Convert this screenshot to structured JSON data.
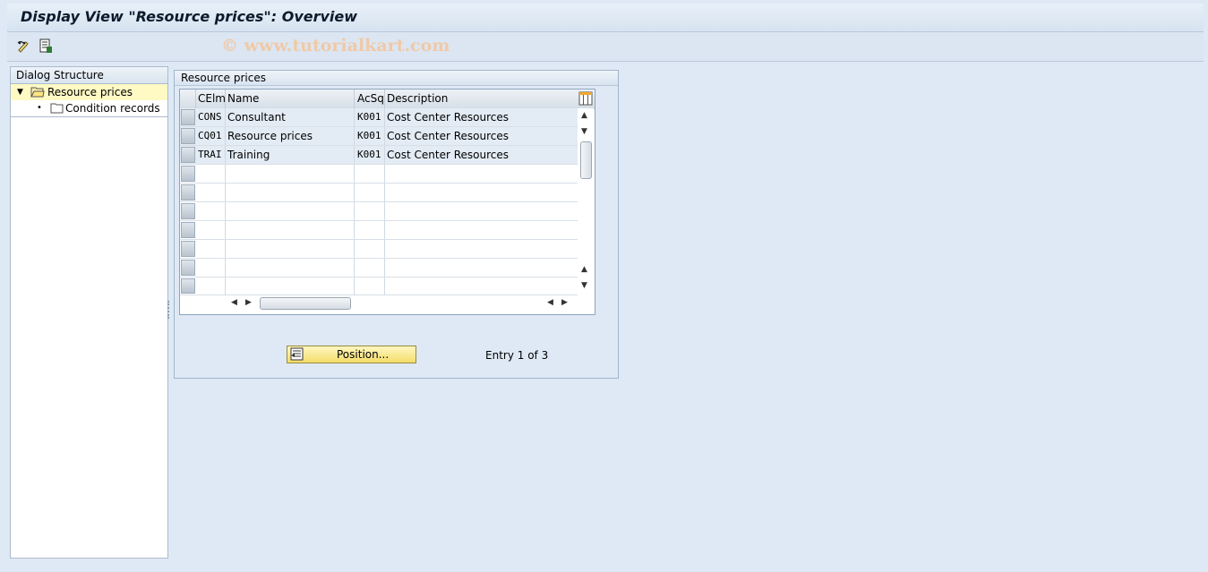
{
  "window": {
    "title": "Display View \"Resource prices\": Overview"
  },
  "watermark": "© www.tutorialkart.com",
  "toolbar": {
    "buttons": [
      {
        "icon": "display-change-icon"
      },
      {
        "icon": "details-icon"
      }
    ]
  },
  "dialog_structure": {
    "header": "Dialog Structure",
    "items": [
      {
        "label": "Resource prices",
        "selected": true,
        "expanded": true
      },
      {
        "label": "Condition records",
        "selected": false
      }
    ]
  },
  "group": {
    "title": "Resource prices"
  },
  "table": {
    "columns": [
      "CElm",
      "Name",
      "AcSq",
      "Description"
    ],
    "rows": [
      {
        "celm": "CONS",
        "name": "Consultant",
        "acsq": "K001",
        "description": "Cost Center Resources"
      },
      {
        "celm": "CQ01",
        "name": "Resource prices",
        "acsq": "K001",
        "description": "Cost Center Resources"
      },
      {
        "celm": "TRAI",
        "name": "Training",
        "acsq": "K001",
        "description": "Cost Center Resources"
      }
    ],
    "empty_rows": 7
  },
  "position_button": {
    "label": "Position..."
  },
  "entry_info": "Entry 1 of 3",
  "colors": {
    "background": "#dfe9f5",
    "selected_item": "#fff9c4",
    "button_yellow": "#f5dd6a"
  }
}
